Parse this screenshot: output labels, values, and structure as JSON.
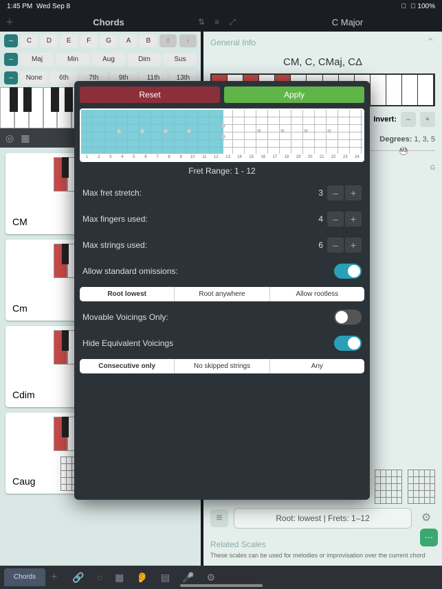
{
  "status": {
    "time": "1:45 PM",
    "date": "Wed Sep 8",
    "battery": "100%"
  },
  "header": {
    "chords": "Chords",
    "key": "C Major"
  },
  "notes": [
    "C",
    "D",
    "E",
    "F",
    "G",
    "A",
    "B"
  ],
  "qualities": [
    "Maj",
    "Min",
    "Aug",
    "Dim",
    "Sus"
  ],
  "extensions": [
    "None",
    "6th",
    "7th",
    "9th",
    "11th",
    "13th"
  ],
  "chordCards": [
    {
      "label": "CM"
    },
    {
      "label": "Cm"
    },
    {
      "label": "Cdim"
    },
    {
      "label": "Caug"
    }
  ],
  "right": {
    "generalInfo": "General Info",
    "names": "CM, C, CMaj, CΔ",
    "invert": "Invert:",
    "degreesLabel": "Degrees:",
    "degrees": "1, 3, 5",
    "intervalBadge": "M3",
    "noteEnd": "G",
    "voicingSummary": "Root: lowest  |  Frets: 1–12",
    "relatedHeader": "Related Scales",
    "relatedText": "These scales can be used for melodies or improvisation over the current chord"
  },
  "modal": {
    "reset": "Reset",
    "apply": "Apply",
    "fretNumbers": [
      "1",
      "2",
      "3",
      "4",
      "5",
      "6",
      "7",
      "8",
      "9",
      "10",
      "11",
      "12",
      "13",
      "14",
      "15",
      "16",
      "17",
      "18",
      "19",
      "20",
      "21",
      "22",
      "23",
      "24"
    ],
    "rangeLabel": "Fret Range: 1 - 12",
    "rows": {
      "stretch": {
        "label": "Max fret stretch:",
        "value": "3"
      },
      "fingers": {
        "label": "Max fingers used:",
        "value": "4"
      },
      "strings": {
        "label": "Max strings used:",
        "value": "6"
      },
      "omissions": {
        "label": "Allow standard omissions:"
      },
      "movable": {
        "label": "Movable Voicings Only:"
      },
      "hideEq": {
        "label": "Hide Equivalent Voicings"
      }
    },
    "seg1": [
      "Root lowest",
      "Root anywhere",
      "Allow rootless"
    ],
    "seg1Selected": 0,
    "seg2": [
      "Consecutive only",
      "No skipped strings",
      "Any"
    ],
    "seg2Selected": 0,
    "toggles": {
      "omissions": true,
      "movable": false,
      "hideEq": true
    }
  },
  "tabs": {
    "chords": "Chords"
  }
}
